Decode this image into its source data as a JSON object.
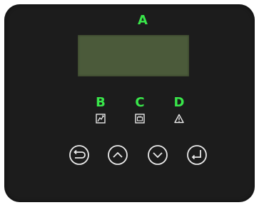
{
  "labels": {
    "display": "A",
    "indicator_1": "B",
    "indicator_2": "C",
    "indicator_3": "D"
  },
  "colors": {
    "label": "#39e64a",
    "panel": "#1c1c1c",
    "lcd": "#4b5a3a",
    "icon": "#e8e8e8"
  },
  "icons": {
    "indicator_1": "grid-status-icon",
    "indicator_2": "battery-status-icon",
    "indicator_3": "warning-icon",
    "buttons": [
      "escape-icon",
      "up-icon",
      "down-icon",
      "enter-icon"
    ]
  }
}
